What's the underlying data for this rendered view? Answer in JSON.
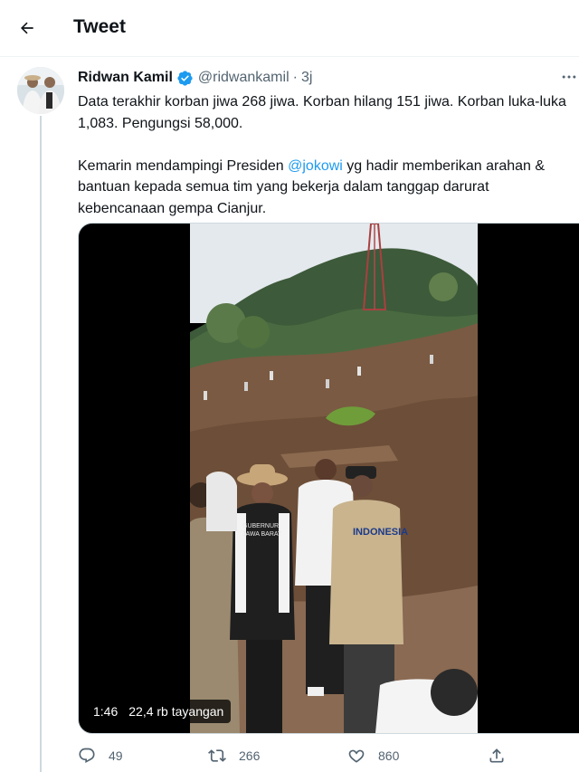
{
  "header": {
    "back_icon": "arrow-left-icon",
    "title": "Tweet"
  },
  "tweet": {
    "author": {
      "name": "Ridwan Kamil",
      "handle": "@ridwankamil",
      "separator": "·",
      "time": "3j",
      "verified": true
    },
    "text": {
      "line1": "Data terakhir korban jiwa 268 jiwa. Korban hilang 151 jiwa. Korban luka-luka",
      "line2": "1,083. Pengungsi 58,000.",
      "line3_before": "Kemarin mendampingi Presiden ",
      "line3_mention": "@jokowi",
      "line3_after": " yg hadir memberikan arahan &",
      "line4": "bantuan kepada semua tim yang bekerja dalam tanggap darurat",
      "line5": "kebencanaan gempa Cianjur."
    },
    "video": {
      "duration": "1:46",
      "views": "22,4 rb tayangan",
      "vest_text_1": "INDONESIA",
      "vest_text_2": "GUBERNUR",
      "vest_text_3": "JAWA BARAT"
    },
    "actions": {
      "replies": "49",
      "retweets": "266",
      "likes": "860"
    }
  },
  "colors": {
    "accent": "#1d9bf0",
    "text": "#0f1419",
    "muted": "#536471"
  }
}
